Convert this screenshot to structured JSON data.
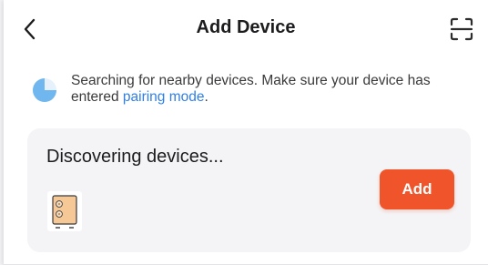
{
  "header": {
    "title": "Add Device",
    "back_icon": "chevron-left-icon",
    "scan_icon": "scan-frame-icon"
  },
  "search_hint": {
    "text": "Searching for nearby devices. Make sure your device has entered ",
    "link_text": "pairing mode",
    "suffix": ".",
    "status_icon": "spinner-icon"
  },
  "discovery": {
    "title": "Discovering devices...",
    "device_icon": "wall-switch-device-icon",
    "add_label": "Add"
  },
  "colors": {
    "accent": "#f0542a",
    "link": "#2f7fe6",
    "card_background": "#f4f4f6",
    "spinner": "#6fb7ee",
    "device_panel": "#f6c896"
  }
}
